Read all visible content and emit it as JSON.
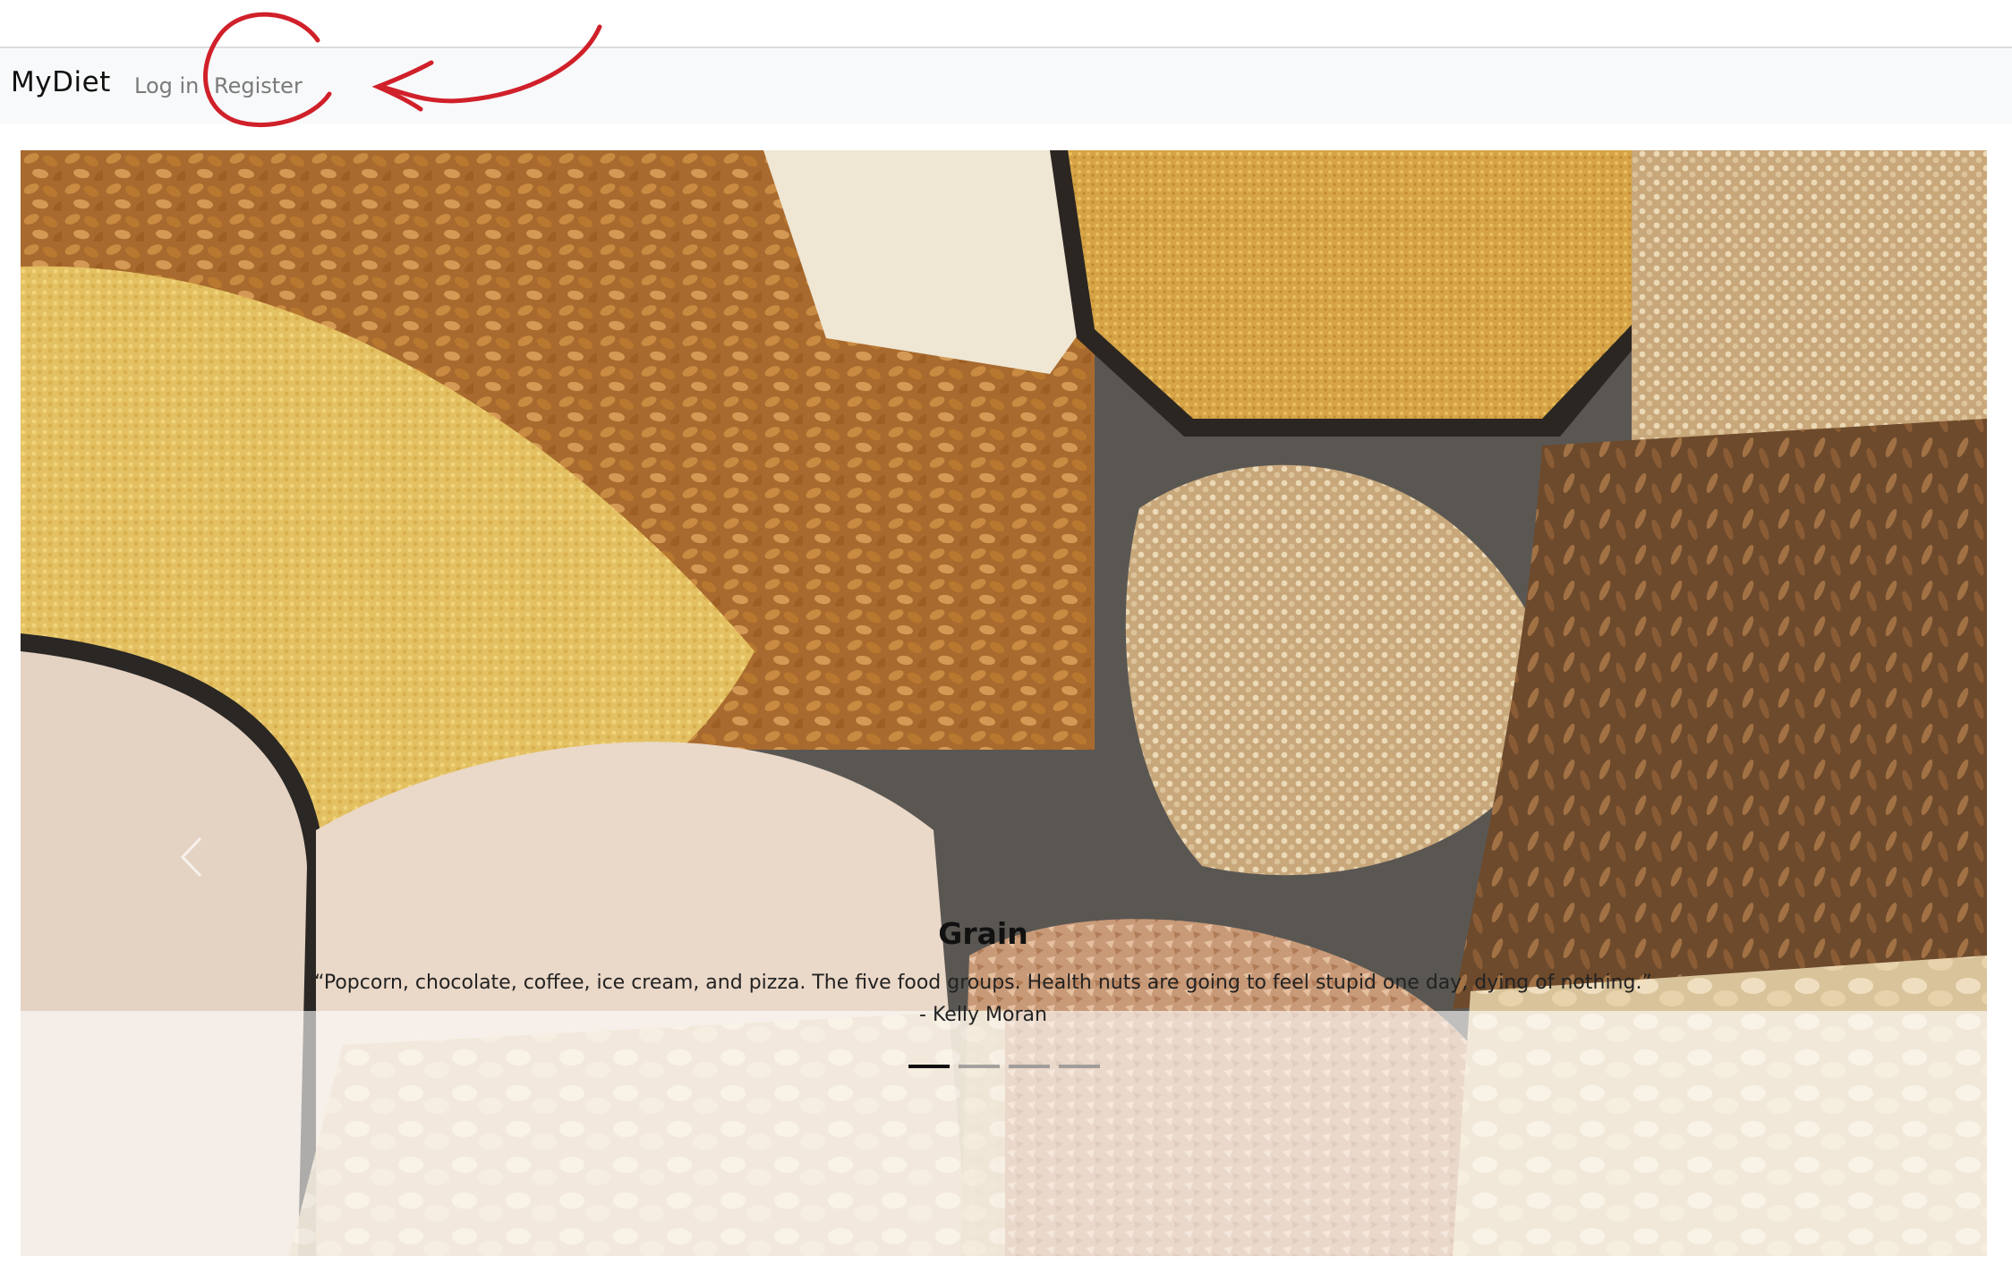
{
  "navbar": {
    "brand": "MyDiet",
    "login_label": "Log in",
    "register_label": "Register"
  },
  "carousel": {
    "slides": [
      {
        "title": "Grain",
        "quote": "“Popcorn, chocolate, coffee, ice cream, and pizza. The five food groups. Health nuts are going to feel stupid one day, dying of nothing.”",
        "author": "- Kelly Moran",
        "image": "grains-photo"
      }
    ],
    "active_index": 0,
    "indicator_count": 4
  },
  "icons": {
    "prev": "chevron-left-icon"
  },
  "colors": {
    "annotation": "#d0202a",
    "navbar_bg": "#f8f9fa",
    "nav_link": "#7a7a7a"
  }
}
